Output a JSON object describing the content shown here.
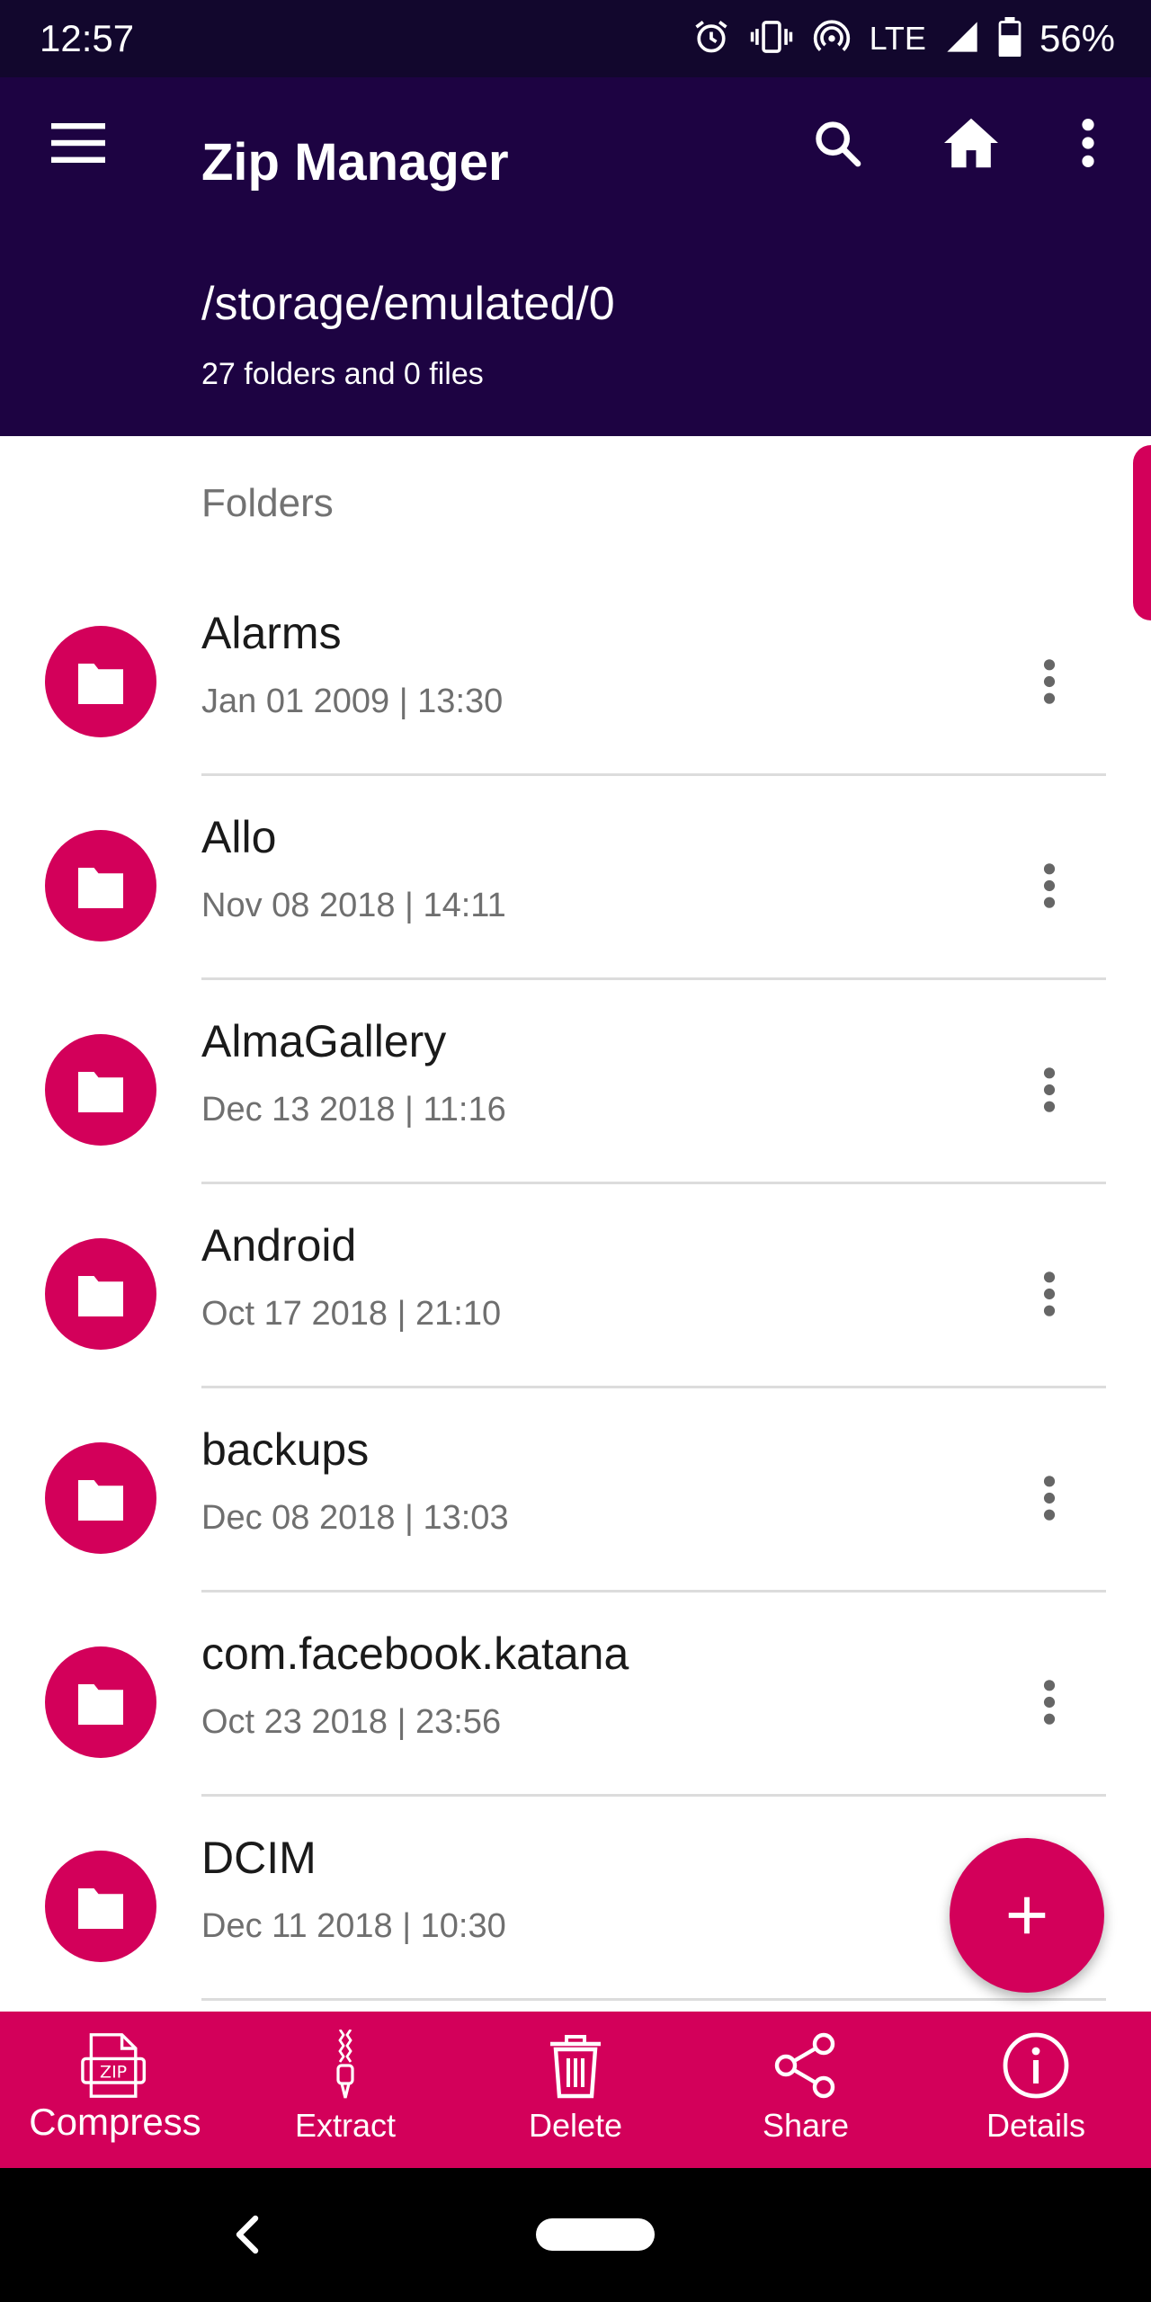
{
  "status_bar": {
    "time": "12:57",
    "network": "LTE",
    "battery": "56%"
  },
  "app_bar": {
    "title": "Zip Manager",
    "path": "/storage/emulated/0",
    "summary": "27 folders and 0 files"
  },
  "section": {
    "title": "Folders"
  },
  "folders": [
    {
      "name": "Alarms",
      "date": "Jan 01 2009 | 13:30"
    },
    {
      "name": "Allo",
      "date": "Nov 08 2018 | 14:11"
    },
    {
      "name": "AlmaGallery",
      "date": "Dec 13 2018 | 11:16"
    },
    {
      "name": "Android",
      "date": "Oct 17 2018 | 21:10"
    },
    {
      "name": "backups",
      "date": "Dec 08 2018 | 13:03"
    },
    {
      "name": "com.facebook.katana",
      "date": "Oct 23 2018 | 23:56"
    },
    {
      "name": "DCIM",
      "date": "Dec 11 2018 | 10:30"
    }
  ],
  "bottom_bar": {
    "compress": "Compress",
    "compress_icon_text": "ZIP",
    "extract": "Extract",
    "delete": "Delete",
    "share": "Share",
    "details": "Details"
  },
  "colors": {
    "accent": "#d3005a",
    "appbar": "#1d0342",
    "statusbar": "#12072d"
  },
  "icons": [
    "menu-icon",
    "search-icon",
    "home-icon",
    "more-vert-icon",
    "folder-icon",
    "add-icon",
    "zip-file-icon",
    "zipper-icon",
    "trash-icon",
    "share-icon",
    "info-icon",
    "back-icon"
  ]
}
